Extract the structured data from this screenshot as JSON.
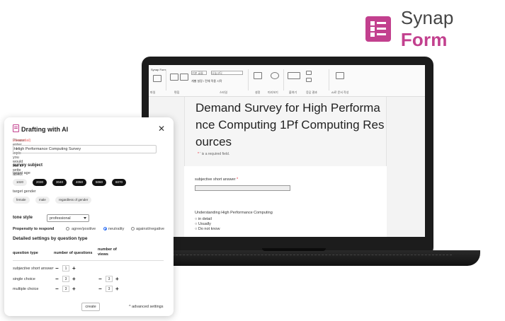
{
  "brand": {
    "name_plain": "Synap ",
    "name_bold": "Form",
    "logo_icon": "form-list-icon",
    "accent": "#c2408e"
  },
  "editor": {
    "app_label": "Synap Form",
    "ribbon": {
      "group_labels": [
        "파일",
        "편집",
        "서식",
        "스타일",
        "설정",
        "미리보기",
        "붙여기",
        "응답 결과",
        "AI로 문서 작성"
      ],
      "font_size": "기본 글꼴",
      "font_name": "나눔고딕",
      "required_toggle": "개별 설정 / 전체 적용 시작"
    },
    "document": {
      "title": "Demand Survey for High Performance Computing 1Pf Computing Resources",
      "required_star": "*",
      "required_note": "is a required field.",
      "question1": {
        "label": "subjective short answer",
        "star": "*"
      },
      "question2": {
        "label": "Understanding High Performance Computing",
        "options": [
          "in detail",
          "Usually",
          "Do not know"
        ]
      }
    }
  },
  "panel": {
    "title": "Drafting with AI",
    "close": "✕",
    "prompt": "Please enter the topic you would like to write about",
    "prompt_required": "(essential)",
    "topic_value": "High Performance Computing Survey",
    "subject_heading": "survey subject",
    "age_label": "target age",
    "ages": [
      {
        "label": "1020",
        "selected": false
      },
      {
        "label": "2030",
        "selected": true
      },
      {
        "label": "3040",
        "selected": true
      },
      {
        "label": "4050",
        "selected": true
      },
      {
        "label": "5060",
        "selected": true
      },
      {
        "label": "6070",
        "selected": true
      }
    ],
    "gender_label": "target gender",
    "genders": [
      "female",
      "male",
      "regardless of gender"
    ],
    "tone_label": "tone style",
    "tone_value": "professional",
    "propensity_label": "Propensity to respond",
    "propensity_options": [
      {
        "label": "agree/positive",
        "selected": false
      },
      {
        "label": "neutrality",
        "selected": true
      },
      {
        "label": "against/negative",
        "selected": false
      }
    ],
    "detail_heading": "Detailed settings by question type",
    "col_type": "question type",
    "col_questions": "number of questions",
    "col_views": "number of views",
    "rows": [
      {
        "type": "subjective short answer",
        "questions": "1",
        "views": null
      },
      {
        "type": "single choice",
        "questions": "3",
        "views": "3"
      },
      {
        "type": "multiple choice",
        "questions": "3",
        "views": "3"
      }
    ],
    "minus": "−",
    "plus": "+",
    "create_label": "create",
    "advanced_label": "advanced settings",
    "advanced_caret": "^"
  }
}
